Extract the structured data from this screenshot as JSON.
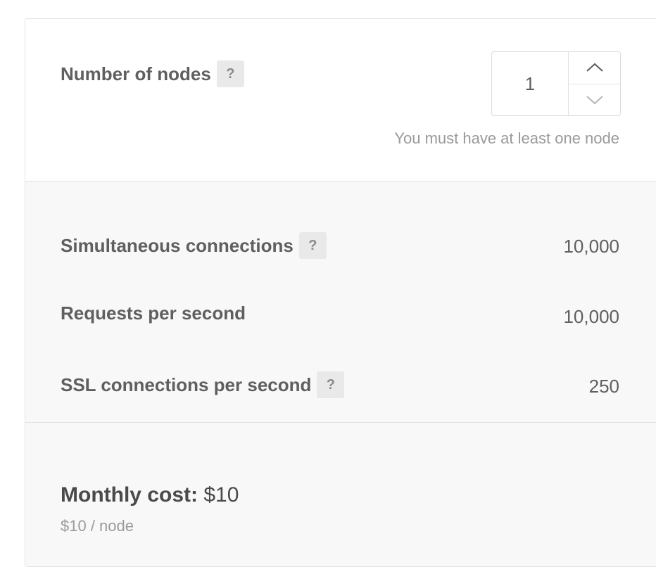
{
  "nodes": {
    "label": "Number of nodes",
    "help": "?",
    "value": "1",
    "hint": "You must have at least one node"
  },
  "specs": [
    {
      "label": "Simultaneous connections",
      "help": "?",
      "value": "10,000"
    },
    {
      "label": "Requests per second",
      "value": "10,000"
    },
    {
      "label": "SSL connections per second",
      "help": "?",
      "value": "250"
    }
  ],
  "cost": {
    "label": "Monthly cost:",
    "value": "$10",
    "per_node": "$10 / node"
  },
  "icons": {
    "increment": "chevron-up-icon",
    "decrement": "chevron-down-icon"
  }
}
